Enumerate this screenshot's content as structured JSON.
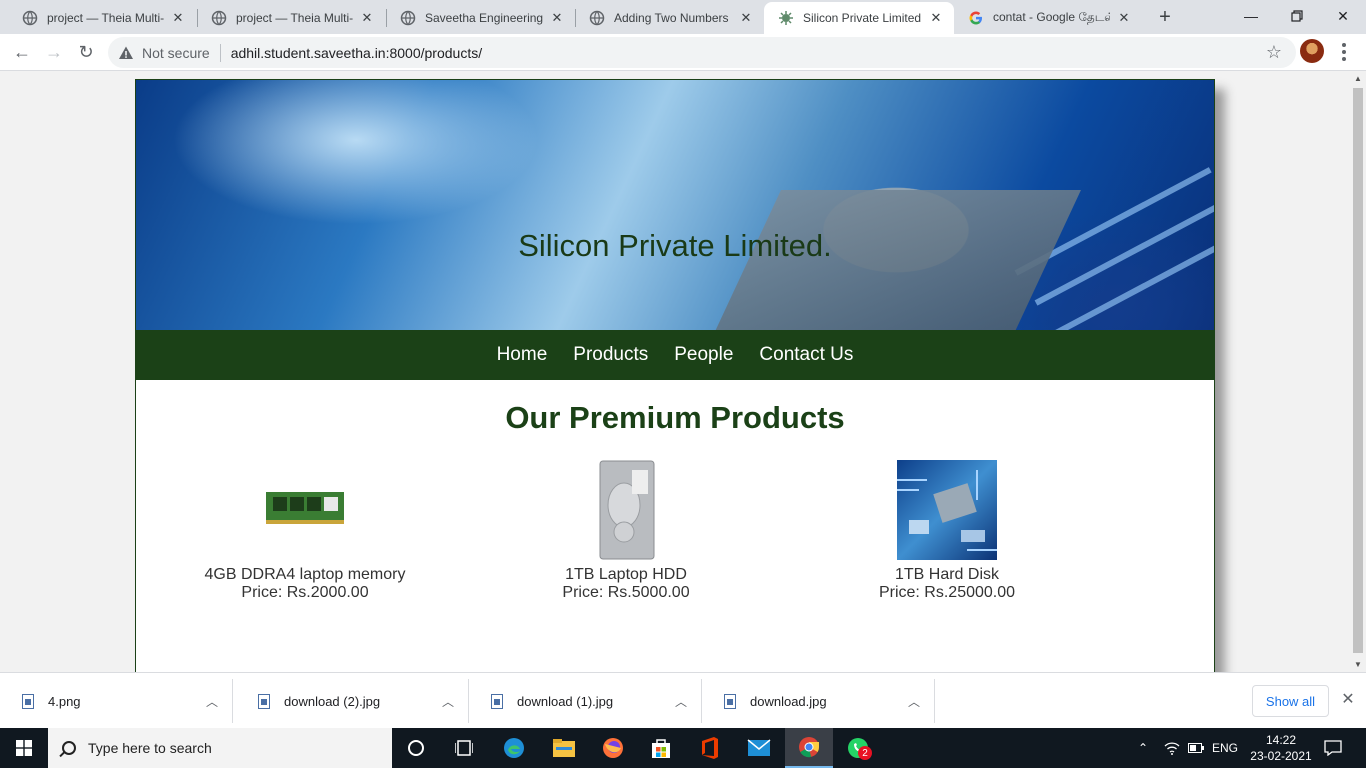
{
  "browser": {
    "tabs": [
      {
        "title": "project — Theia Multi-L",
        "active": false
      },
      {
        "title": "project — Theia Multi-L",
        "active": false
      },
      {
        "title": "Saveetha Engineering C",
        "active": false
      },
      {
        "title": "Adding Two Numbers",
        "active": false
      },
      {
        "title": "Silicon Private Limited",
        "active": true
      },
      {
        "title": "contat - Google தேடல்",
        "active": false
      }
    ],
    "new_tab_label": "+",
    "security_label": "Not secure",
    "url": "adhil.student.saveetha.in:8000/products/"
  },
  "site": {
    "title": "Silicon Private Limited.",
    "nav": [
      "Home",
      "Products",
      "People",
      "Contact Us"
    ],
    "heading": "Our Premium Products",
    "products": [
      {
        "name": "4GB DDRA4 laptop memory",
        "price": "Price: Rs.2000.00",
        "image": "ram-module"
      },
      {
        "name": "1TB Laptop HDD",
        "price": "Price: Rs.5000.00",
        "image": "hard-drive"
      },
      {
        "name": "1TB Hard Disk",
        "price": "Price: Rs.25000.00",
        "image": "circuit-board"
      }
    ]
  },
  "downloads": {
    "items": [
      "4.png",
      "download (2).jpg",
      "download (1).jpg",
      "download.jpg"
    ],
    "show_all_label": "Show all"
  },
  "taskbar": {
    "search_placeholder": "Type here to search",
    "language": "ENG",
    "time": "14:22",
    "date": "23-02-2021",
    "whatsapp_badge": "2"
  },
  "colors": {
    "site_green": "#1b4117",
    "tabstrip": "#dee1e6",
    "link_blue": "#1a73e8"
  }
}
